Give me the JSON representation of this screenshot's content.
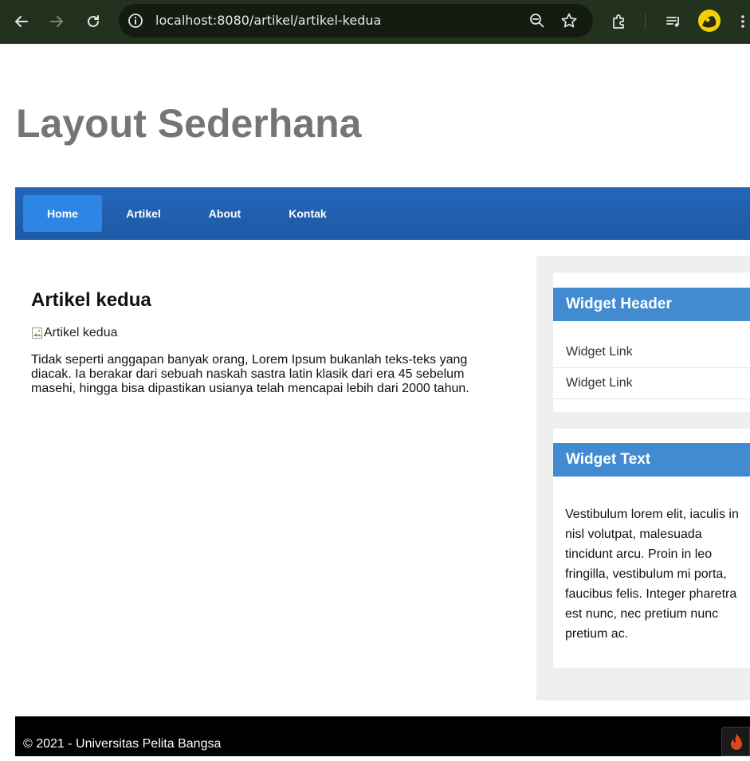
{
  "browser": {
    "url": "localhost:8080/artikel/artikel-kedua",
    "icons": [
      "back-arrow-icon",
      "forward-arrow-icon",
      "reload-icon",
      "site-info-icon",
      "zoom-icon",
      "bookmark-star-icon",
      "extensions-icon",
      "media-queue-icon",
      "profile-avatar"
    ]
  },
  "site": {
    "title": "Layout Sederhana"
  },
  "nav": {
    "items": [
      {
        "label": "Home",
        "active": true
      },
      {
        "label": "Artikel",
        "active": false
      },
      {
        "label": "About",
        "active": false
      },
      {
        "label": "Kontak",
        "active": false
      }
    ]
  },
  "article": {
    "title": "Artikel kedua",
    "image_alt": "Artikel kedua",
    "body": "Tidak seperti anggapan banyak orang, Lorem Ipsum bukanlah teks-teks yang diacak. Ia berakar dari sebuah naskah sastra latin klasik dari era 45 sebelum masehi, hingga bisa dipastikan usianya telah mencapai lebih dari 2000 tahun."
  },
  "sidebar": {
    "widget1": {
      "header": "Widget Header",
      "links": [
        "Widget Link",
        "Widget Link"
      ]
    },
    "widget2": {
      "header": "Widget Text",
      "text": "Vestibulum lorem elit, iaculis in nisl volutpat, malesuada tincidunt arcu. Proin in leo fringilla, vestibulum mi porta, faucibus felis. Integer pharetra est nunc, nec pretium nunc pretium ac."
    }
  },
  "footer": {
    "text": "© 2021 - Universitas Pelita Bangsa"
  },
  "colors": {
    "navbar": "#2366b8",
    "nav_active": "#2d86e3",
    "widget_header": "#428bd1",
    "sidebar_bg": "#efefef",
    "footer_bg": "#000000",
    "title": "#757575"
  }
}
